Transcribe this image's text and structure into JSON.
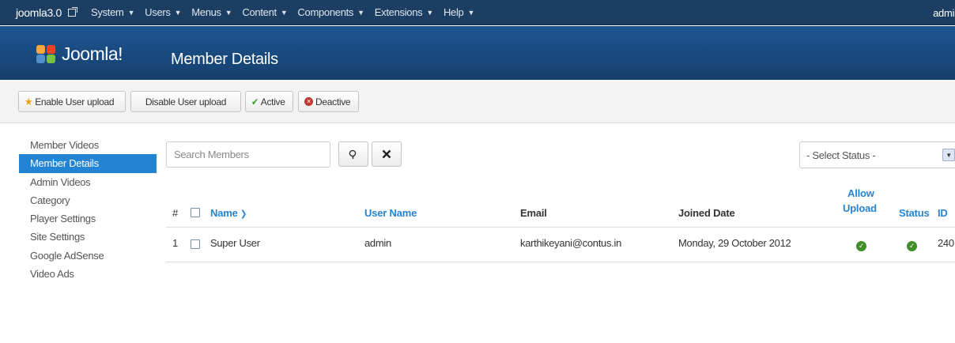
{
  "topnav": {
    "site_name": "joomla3.0",
    "menus": [
      {
        "label": "System"
      },
      {
        "label": "Users"
      },
      {
        "label": "Menus"
      },
      {
        "label": "Content"
      },
      {
        "label": "Components"
      },
      {
        "label": "Extensions"
      },
      {
        "label": "Help"
      }
    ],
    "user": "admin"
  },
  "header": {
    "logo_text": "Joomla!",
    "title": "Member Details"
  },
  "toolbar": {
    "enable_upload": "Enable User upload",
    "disable_upload": "Disable User upload",
    "active": "Active",
    "deactive": "Deactive"
  },
  "sidebar": {
    "items": [
      {
        "label": "Member Videos"
      },
      {
        "label": "Member Details"
      },
      {
        "label": "Admin Videos"
      },
      {
        "label": "Category"
      },
      {
        "label": "Player Settings"
      },
      {
        "label": "Site Settings"
      },
      {
        "label": "Google AdSense"
      },
      {
        "label": "Video Ads"
      }
    ],
    "active_index": 1
  },
  "filters": {
    "search_placeholder": "Search Members",
    "status_select": "- Select Status -"
  },
  "table": {
    "headers": {
      "num": "#",
      "name": "Name",
      "username": "User Name",
      "email": "Email",
      "joined": "Joined Date",
      "allow_upload_1": "Allow",
      "allow_upload_2": "Upload",
      "status": "Status",
      "id": "ID"
    },
    "rows": [
      {
        "num": "1",
        "name": "Super User",
        "username": "admin",
        "email": "karthikeyani@contus.in",
        "joined": "Monday, 29 October 2012",
        "allow_upload": true,
        "status": true,
        "id": "240"
      }
    ]
  },
  "colors": {
    "topnav_bg": "#1c3e63",
    "header_bg": "#184a7e",
    "accent": "#2384d3",
    "ok_green": "#3f8f26"
  }
}
